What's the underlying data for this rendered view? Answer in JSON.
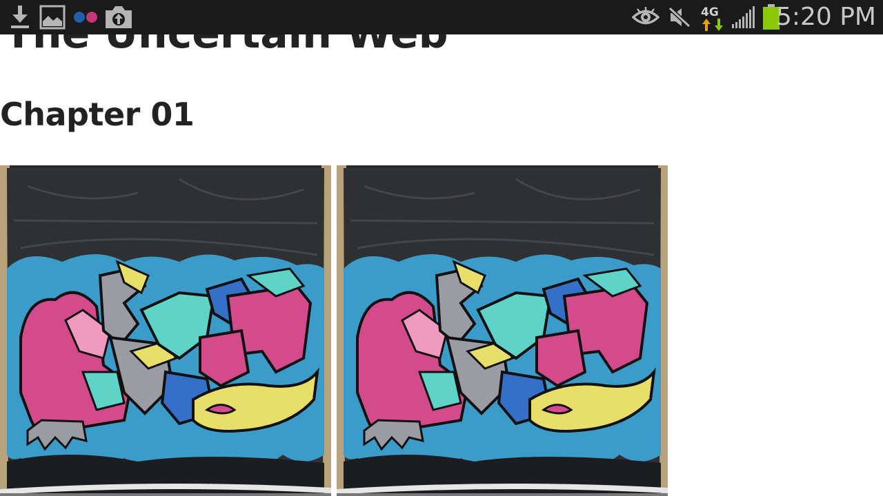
{
  "status_bar": {
    "clock": "5:20 PM",
    "network_type": "4G",
    "notification_icons": [
      "download-icon",
      "gallery-icon",
      "flickr-icon",
      "camera-upload-icon"
    ],
    "system_icons": [
      "eye-icon",
      "mute-icon",
      "network-data-icon",
      "signal-icon",
      "battery-icon"
    ],
    "colors": {
      "background": "#1a1a1a",
      "icon": "#b5b5b5",
      "battery": "#8bc80a",
      "data_up": "#8bc80a",
      "data_down": "#e8a000"
    }
  },
  "page": {
    "site_title": "The Uncertain Web",
    "chapter_title": "Chapter 01",
    "images": [
      {
        "subject": "graffiti mural on blue tarp, original"
      },
      {
        "subject": "graffiti mural on blue tarp, processed"
      }
    ]
  }
}
